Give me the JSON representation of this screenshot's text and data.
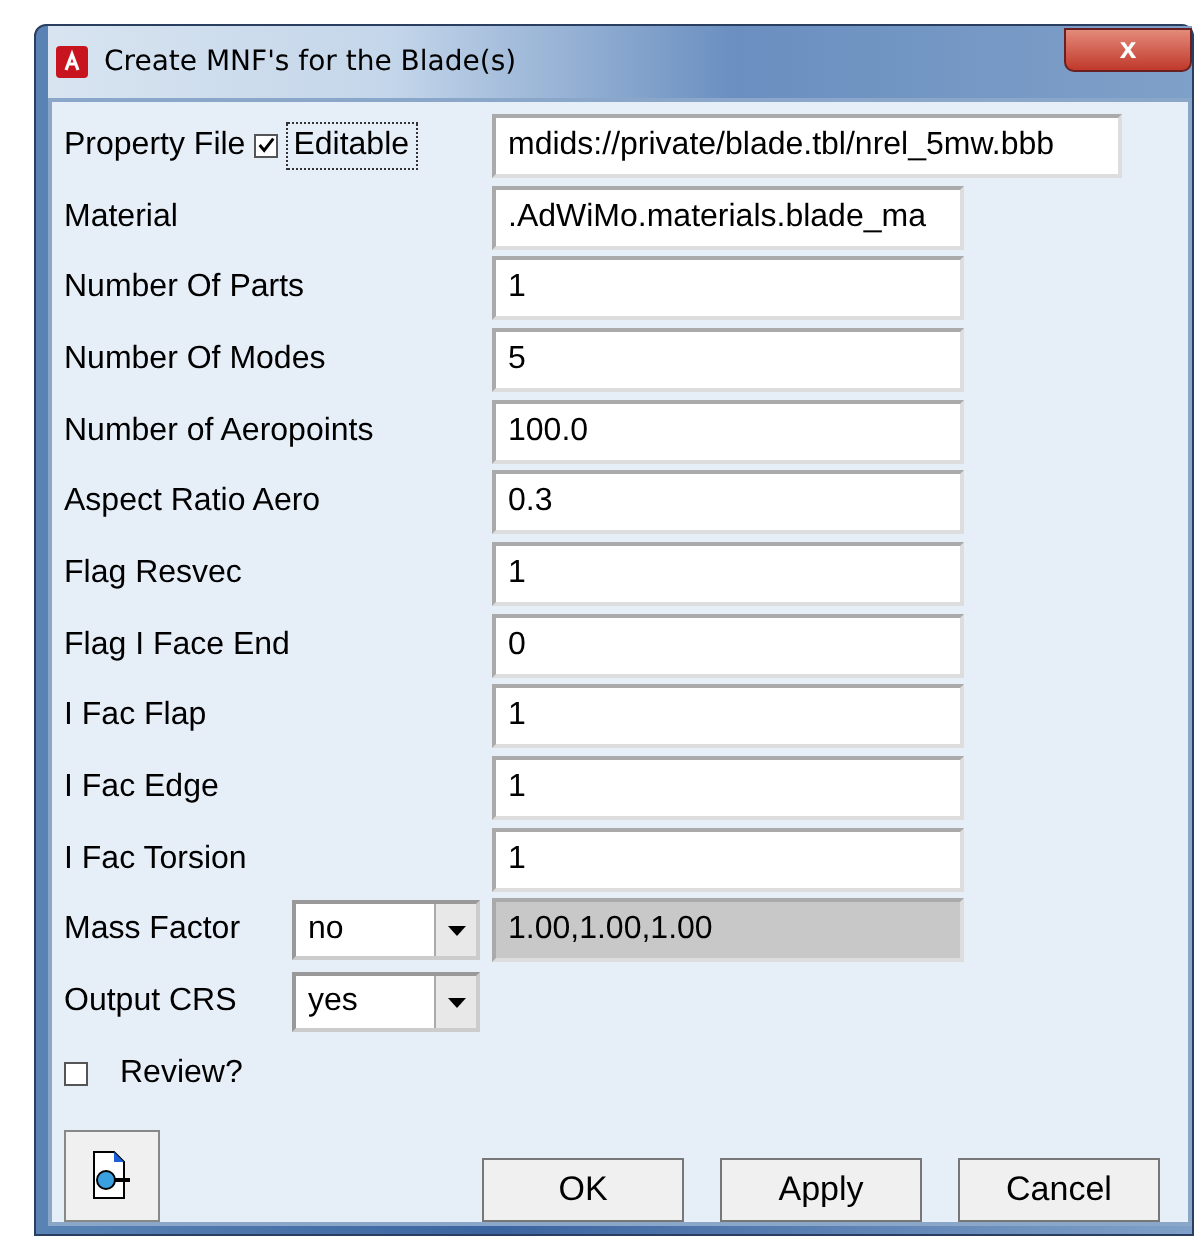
{
  "window": {
    "title": "Create MNF's for the Blade(s)",
    "close": "x"
  },
  "property_file": {
    "label": "Property File",
    "editable_label": "Editable",
    "editable_checked": true,
    "value": "mdids://private/blade.tbl/nrel_5mw.bbb"
  },
  "fields": [
    {
      "label": "Material",
      "value": ".AdWiMo.materials.blade_ma"
    },
    {
      "label": "Number Of Parts",
      "value": "1"
    },
    {
      "label": "Number Of Modes",
      "value": "5"
    },
    {
      "label": "Number of Aeropoints",
      "value": "100.0"
    },
    {
      "label": "Aspect Ratio Aero",
      "value": "0.3"
    },
    {
      "label": "Flag Resvec",
      "value": "1"
    },
    {
      "label": "Flag I Face End",
      "value": "0"
    },
    {
      "label": "I Fac Flap",
      "value": "1"
    },
    {
      "label": "I Fac Edge",
      "value": "1"
    },
    {
      "label": "I Fac Torsion",
      "value": "1"
    }
  ],
  "combos": [
    {
      "label": "Mass Factor",
      "value": "no",
      "field": {
        "value": "1.00,1.00,1.00",
        "disabled": true
      }
    },
    {
      "label": "Output CRS",
      "value": "yes"
    }
  ],
  "review": {
    "label": "Review?",
    "checked": false
  },
  "buttons": [
    "OK",
    "Apply",
    "Cancel"
  ]
}
